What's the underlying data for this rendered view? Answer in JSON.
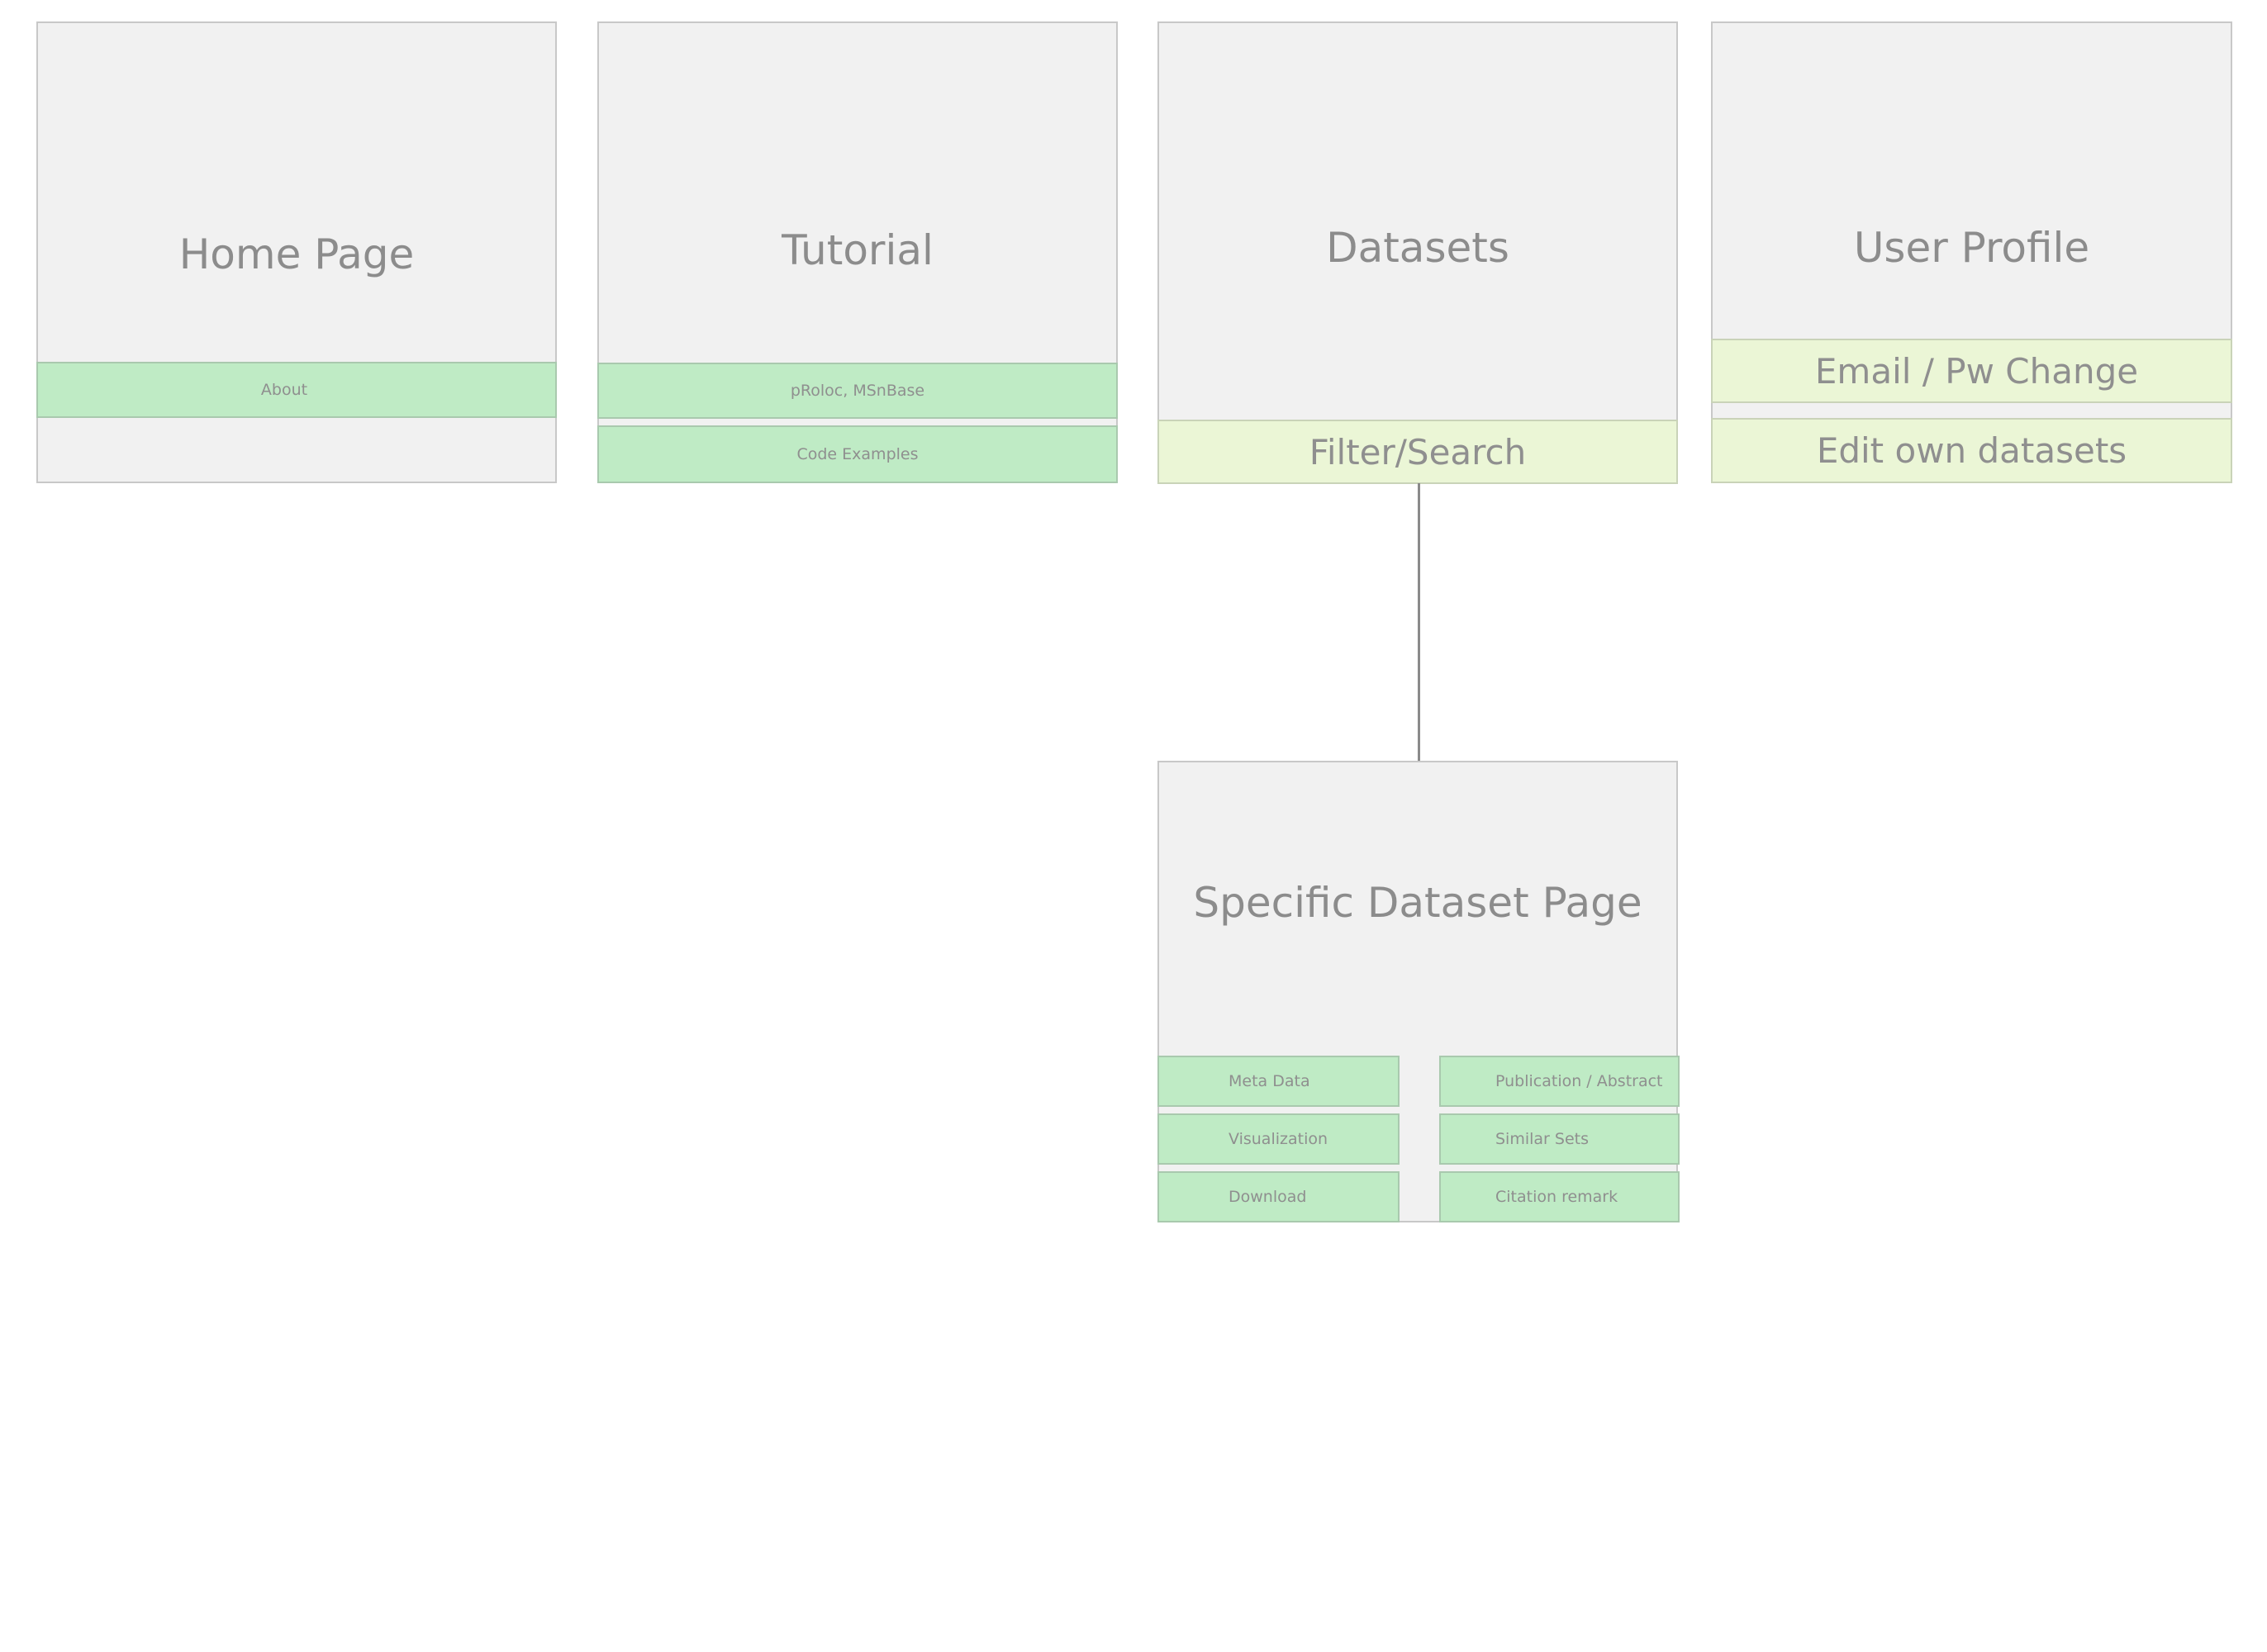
{
  "diagram": {
    "home": {
      "title": "Home Page",
      "items": [
        "About"
      ]
    },
    "tutorial": {
      "title": "Tutorial",
      "items": [
        "pRoloc, MSnBase",
        "Code Examples"
      ]
    },
    "datasets": {
      "title": "Datasets",
      "items": [
        "Filter/Search"
      ]
    },
    "profile": {
      "title": "User Profile",
      "items": [
        "Email / Pw Change",
        "Edit own datasets"
      ]
    },
    "specific": {
      "title": "Specific Dataset Page",
      "left_items": [
        "Meta Data",
        "Visualization",
        "Download"
      ],
      "right_items": [
        "Publication / Abstract",
        "Similar Sets",
        "Citation remark"
      ]
    }
  },
  "colors": {
    "box_fill": "#f1f1f1",
    "box_border": "#c8c8c8",
    "green_item": "#bfebc5",
    "lime_item": "#ebf6d6",
    "text": "#8c8c8c",
    "connector": "#8a8a8a"
  }
}
